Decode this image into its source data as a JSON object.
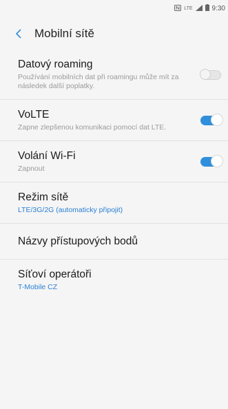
{
  "status_bar": {
    "time": "9:30",
    "icons": [
      "nfc-icon",
      "lte-icon",
      "signal-icon",
      "battery-icon"
    ],
    "lte_text": "LTE"
  },
  "header": {
    "title": "Mobilní sítě"
  },
  "colors": {
    "accent": "#2f8fdc",
    "accent_text": "#2a7fd5"
  },
  "items": [
    {
      "label": "Datový roaming",
      "sub": "Používání mobilních dat při roamingu může mít za následek další poplatky.",
      "toggle": false
    },
    {
      "label": "VoLTE",
      "sub": "Zapne zlepšenou komunikaci pomocí dat LTE.",
      "toggle": true
    },
    {
      "label": "Volání Wi-Fi",
      "sub": "Zapnout",
      "toggle": true
    },
    {
      "label": "Režim sítě",
      "sub": "LTE/3G/2G (automaticky připojit)"
    },
    {
      "label": "Názvy přístupových bodů"
    },
    {
      "label": "Síťoví operátoři",
      "sub": "T-Mobile CZ"
    }
  ]
}
